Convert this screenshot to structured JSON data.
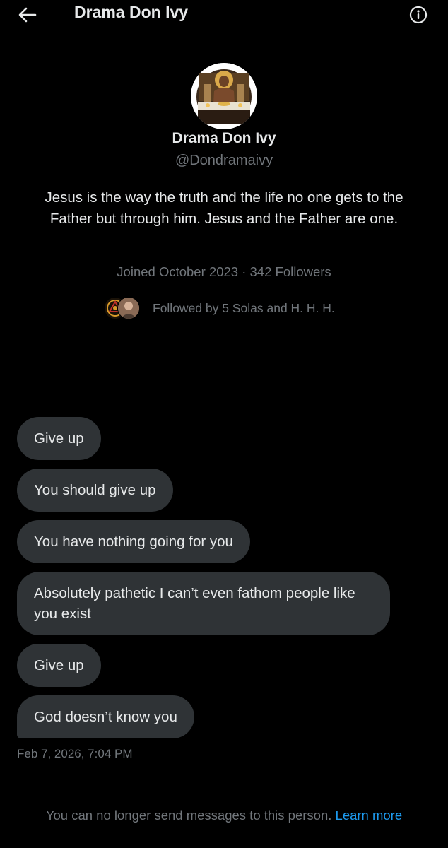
{
  "header": {
    "title": "Drama Don Ivy",
    "back_icon": "arrow-left-icon",
    "info_icon": "info-circle-icon"
  },
  "profile": {
    "name": "Drama Don Ivy",
    "handle": "@Dondramaivy",
    "bio": "Jesus is the way the truth and the life no one gets to the Father but through him. Jesus and the Father are one.",
    "joined": "Joined October 2023",
    "separator": "·",
    "followers": "342 Followers",
    "followed_by": "Followed by 5 Solas and H. H. H."
  },
  "messages": [
    {
      "text": "Give up"
    },
    {
      "text": "You should give up"
    },
    {
      "text": "You have nothing going for you"
    },
    {
      "text": "Absolutely pathetic I can’t even fathom people like you exist"
    },
    {
      "text": "Give up"
    },
    {
      "text": "God doesn’t know you"
    }
  ],
  "timestamp": "Feb 7, 2026, 7:04 PM",
  "footer": {
    "notice": "You can no longer send messages to this person.",
    "link": "Learn more"
  },
  "colors": {
    "background": "#000000",
    "bubble": "#2f3336",
    "text": "#e7e9ea",
    "muted": "#71767b",
    "link": "#1d9bf0"
  }
}
